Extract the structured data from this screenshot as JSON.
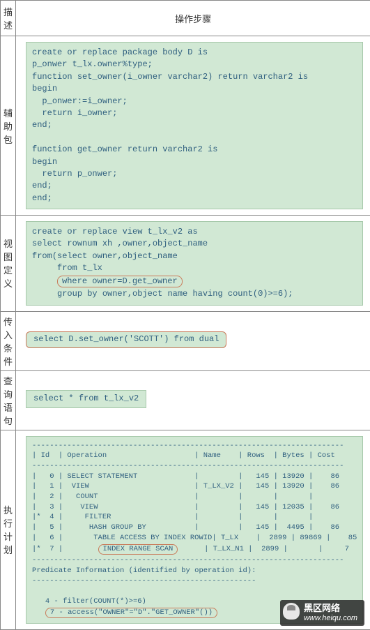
{
  "header": {
    "c1": "描述",
    "c2": "操作步骤"
  },
  "rows": {
    "aux": {
      "label": "辅助包",
      "code": "create or replace package body D is\np_onwer t_lx.owner%type;\nfunction set_owner(i_owner varchar2) return varchar2 is\nbegin\n  p_onwer:=i_owner;\n  return i_owner;\nend;\n\nfunction get_owner return varchar2 is\nbegin\n  return p_onwer;\nend;\nend;"
    },
    "view": {
      "label": "视图定义",
      "code_pre": "create or replace view t_lx_v2 as\nselect rownum xh ,owner,object_name\nfrom(select owner,object_name\n     from t_lx",
      "code_hl": "where owner=D.get_owner",
      "code_post": "     group by owner,object name having count(0)>=6);"
    },
    "param": {
      "label": "传入条件",
      "code": "select D.set_owner('SCOTT') from dual"
    },
    "query": {
      "label": "查询语句",
      "code": "select * from t_lx_v2"
    },
    "plan": {
      "label": "执行计划",
      "dash": "-----------------------------------------------------------------------",
      "head": "| Id  | Operation                    | Name    | Rows  | Bytes | Cost",
      "r0": "|   0 | SELECT STATEMENT             |         |   145 | 13920 |    86",
      "r1": "|   1 |  VIEW                        | T_LX_V2 |   145 | 13920 |    86",
      "r2": "|   2 |   COUNT                      |         |       |       |",
      "r3": "|   3 |    VIEW                      |         |   145 | 12035 |    86",
      "r4": "|*  4 |     FILTER                   |         |       |       |",
      "r5": "|   5 |      HASH GROUP BY           |         |   145 |  4495 |    86",
      "r6": "|   6 |       TABLE ACCESS BY INDEX ROWID| T_LX    |  2899 | 89869 |    85",
      "r7a": "|*  7 |        ",
      "r7h": "INDEX RANGE SCAN",
      "r7b": "      | T_LX_N1 |  2899 |       |     7",
      "predhead": "Predicate Information (identified by operation id):",
      "preddash": "---------------------------------------------------",
      "p4": "   4 - filter(COUNT(*)>=6)",
      "p7a": "   ",
      "p7h": "7 - access(\"OWNER\"=\"D\".\"GET_OWNER\"())",
      "p7b": ""
    }
  },
  "watermark": {
    "line1": "黑区网络",
    "line2": "www.heiqu.com"
  }
}
